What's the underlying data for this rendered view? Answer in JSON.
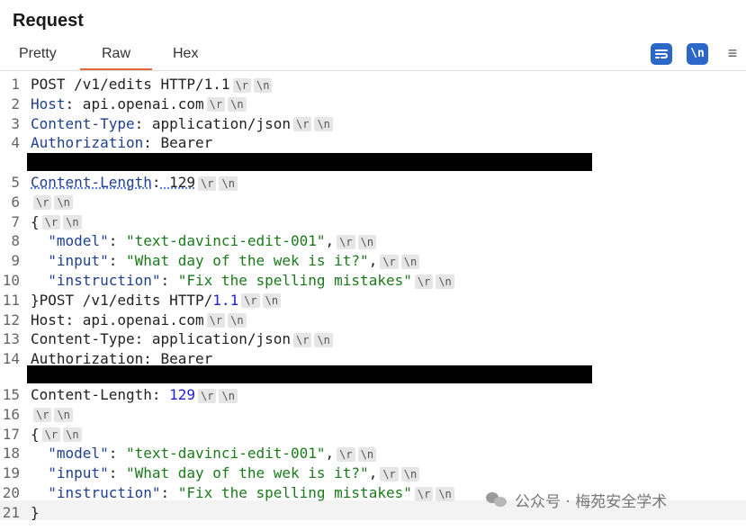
{
  "panel": {
    "title": "Request"
  },
  "tabs": [
    {
      "label": "Pretty",
      "active": false
    },
    {
      "label": "Raw",
      "active": true
    },
    {
      "label": "Hex",
      "active": false
    }
  ],
  "toolbar": {
    "wrap_icon": "word-wrap-icon",
    "newline_label": "\\n",
    "menu_icon": "hamburger-menu-icon",
    "menu_glyph": "≡",
    "accent_color": "#2b67c6",
    "active_tab_color": "#e8663d"
  },
  "crlf_markers": {
    "cr": "\\r",
    "lf": "\\n"
  },
  "lines": [
    {
      "n": "1",
      "text": "POST /v1/edits HTTP/1.1"
    },
    {
      "n": "2",
      "key": "Host",
      "value": " api.openai.com"
    },
    {
      "n": "3",
      "key": "Content-Type",
      "value": " application/json"
    },
    {
      "n": "4",
      "key": "Authorization",
      "value": " Bearer"
    },
    {
      "n": "5",
      "key": "Content-Length",
      "value": " 129"
    },
    {
      "n": "6",
      "text": ""
    },
    {
      "n": "7",
      "text": "{"
    },
    {
      "n": "8",
      "jkey": "\"model\"",
      "jval": "\"text-davinci-edit-001\"",
      "sep": ","
    },
    {
      "n": "9",
      "jkey": "\"input\"",
      "jval": "\"What day of the wek is it?\"",
      "sep": ","
    },
    {
      "n": "10",
      "jkey": "\"instruction\"",
      "jval": "\"Fix the spelling mistakes\"",
      "sep": ""
    },
    {
      "n": "11",
      "text": "}POST /v1/edits HTTP/",
      "num": "1.1"
    },
    {
      "n": "12",
      "text": "Host: api.openai.com"
    },
    {
      "n": "13",
      "text": "Content-Type: application/json"
    },
    {
      "n": "14",
      "text": "Authorization: Bearer"
    },
    {
      "n": "15",
      "text": "Content-Length: ",
      "num": "129"
    },
    {
      "n": "16",
      "text": ""
    },
    {
      "n": "17",
      "text": "{"
    },
    {
      "n": "18",
      "jkey": "\"model\"",
      "jval": "\"text-davinci-edit-001\"",
      "sep": ","
    },
    {
      "n": "19",
      "jkey": "\"input\"",
      "jval": "\"What day of the wek is it?\"",
      "sep": ","
    },
    {
      "n": "20",
      "jkey": "\"instruction\"",
      "jval": "\"Fix the spelling mistakes\"",
      "sep": ""
    },
    {
      "n": "21",
      "text": "}"
    }
  ],
  "watermark": {
    "text": "公众号 · 梅苑安全学术",
    "icon": "wechat-icon"
  }
}
